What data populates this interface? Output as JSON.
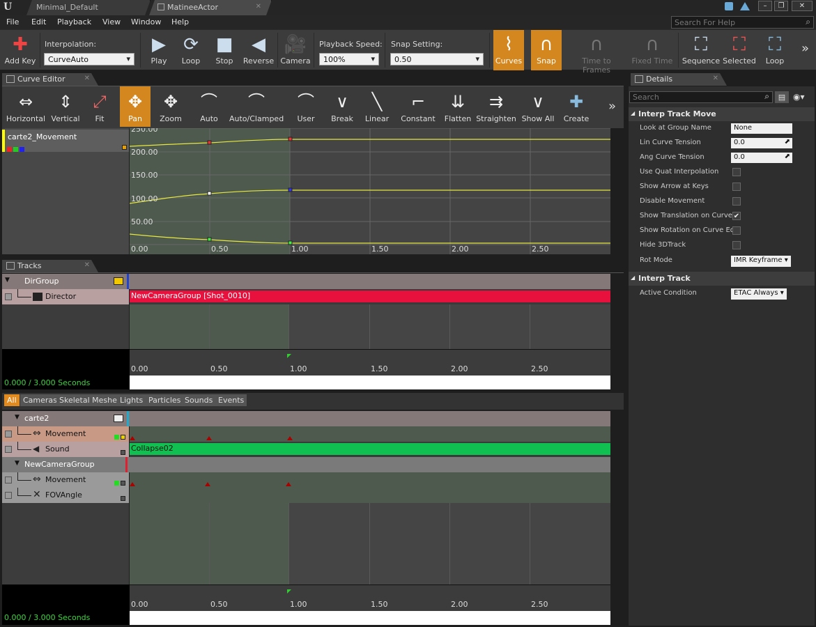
{
  "tabs": [
    {
      "label": "Minimal_Default"
    },
    {
      "label": "MatineeActor"
    }
  ],
  "menu": [
    "File",
    "Edit",
    "Playback",
    "View",
    "Window",
    "Help"
  ],
  "help_search_placeholder": "Search For Help",
  "toolbar": {
    "add_key": "Add Key",
    "interpolation_label": "Interpolation:",
    "interpolation_value": "CurveAuto",
    "play": "Play",
    "loop": "Loop",
    "stop": "Stop",
    "reverse": "Reverse",
    "camera": "Camera",
    "playback_speed_label": "Playback Speed:",
    "playback_speed_value": "100%",
    "snap_setting_label": "Snap Setting:",
    "snap_setting_value": "0.50",
    "curves": "Curves",
    "snap": "Snap",
    "time_to_frames": "Time to Frames",
    "fixed_time": "Fixed Time",
    "sequence": "Sequence",
    "selected": "Selected",
    "loop2": "Loop"
  },
  "curve_editor": {
    "tab": "Curve Editor",
    "buttons": [
      "Horizontal",
      "Vertical",
      "Fit",
      "Pan",
      "Zoom",
      "Auto",
      "Auto/Clamped",
      "User",
      "Break",
      "Linear",
      "Constant",
      "Flatten",
      "Straighten",
      "Show All",
      "Create"
    ],
    "active": "Pan",
    "curve_name": "carte2_Movement",
    "y_labels": [
      "250.00",
      "200.00",
      "150.00",
      "100.00",
      "50.00",
      "0.00"
    ],
    "x_labels": [
      "0.50",
      "1.00",
      "1.50",
      "2.00",
      "2.50"
    ]
  },
  "tracks": {
    "tab": "Tracks",
    "dir_group": "DirGroup",
    "director": "Director",
    "director_shot": "NewCameraGroup [Shot_0010]",
    "ruler": [
      "0.00",
      "0.50",
      "1.00",
      "1.50",
      "2.00",
      "2.50"
    ],
    "seconds": "0.000 / 3.000 Seconds",
    "filters": [
      "All",
      "Cameras",
      "Skeletal Meshes",
      "Lights",
      "Particles",
      "Sounds",
      "Events"
    ],
    "group1": "carte2",
    "g1_tracks": [
      "Movement",
      "Sound"
    ],
    "sound_clip": "Collapse02",
    "group2": "NewCameraGroup",
    "g2_tracks": [
      "Movement",
      "FOVAngle"
    ]
  },
  "details": {
    "tab": "Details",
    "search_placeholder": "Search",
    "cat1": "Interp Track Move",
    "rows": [
      {
        "label": "Look at Group Name",
        "value": "None"
      },
      {
        "label": "Lin Curve Tension",
        "value": "0.0"
      },
      {
        "label": "Ang Curve Tension",
        "value": "0.0"
      },
      {
        "label": "Use Quat Interpolation",
        "value": ""
      },
      {
        "label": "Show Arrow at Keys",
        "value": ""
      },
      {
        "label": "Disable Movement",
        "value": ""
      },
      {
        "label": "Show Translation on Curve",
        "value": "✔"
      },
      {
        "label": "Show Rotation on Curve Ed",
        "value": ""
      },
      {
        "label": "Hide 3DTrack",
        "value": ""
      },
      {
        "label": "Rot Mode",
        "value": "IMR Keyframe"
      }
    ],
    "cat2": "Interp Track",
    "active_condition_label": "Active Condition",
    "active_condition_value": "ETAC Always"
  }
}
